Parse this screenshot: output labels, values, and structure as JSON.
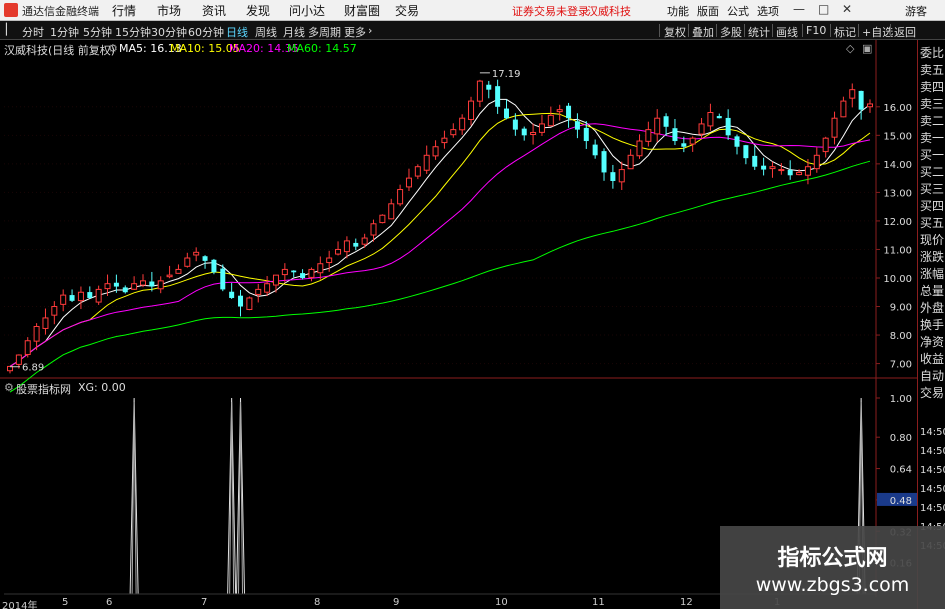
{
  "menubar": {
    "app_title": "通达信金融终端",
    "menus": [
      "行情",
      "市场",
      "资讯",
      "发现",
      "问小达",
      "财富圈",
      "交易"
    ],
    "warning": "证券交易未登录",
    "stock_name": "汉威科技",
    "right_buttons": [
      "功能",
      "版面",
      "公式",
      "选项"
    ],
    "user": "游客"
  },
  "periods": [
    {
      "label": "分时",
      "active": false
    },
    {
      "label": "1分钟",
      "active": false
    },
    {
      "label": "5分钟",
      "active": false
    },
    {
      "label": "15分钟",
      "active": false
    },
    {
      "label": "30分钟",
      "active": false
    },
    {
      "label": "60分钟",
      "active": false
    },
    {
      "label": "日线",
      "active": true
    },
    {
      "label": "周线",
      "active": false
    },
    {
      "label": "月线",
      "active": false
    },
    {
      "label": "多周期",
      "active": false
    },
    {
      "label": "更多",
      "active": false
    }
  ],
  "toolbar_right": [
    "复权",
    "叠加",
    "多股",
    "统计",
    "画线",
    "F10",
    "标记",
    "+自选",
    "返回"
  ],
  "info": {
    "title": "汉威科技(日线 前复权)",
    "ma5": "MA5: 16.13",
    "ma10": "MA10: 15.05",
    "ma20": "MA20: 14.35",
    "ma60": "MA60: 14.57",
    "high_label": "17.19",
    "low_label": "6.89"
  },
  "indicator": {
    "title": "股票指标网",
    "xg": "XG: 0.00"
  },
  "price_axis": {
    "ticks": [
      "16.00",
      "15.00",
      "14.00",
      "13.00",
      "12.00",
      "11.00",
      "10.00",
      "9.00",
      "8.00",
      "7.00"
    ]
  },
  "indicator_axis": {
    "ticks": [
      "1.00",
      "0.80",
      "0.64",
      "0.48",
      "0.32",
      "0.16"
    ],
    "highlight": "0.48"
  },
  "date_axis": [
    "2014年",
    "5",
    "6",
    "7",
    "8",
    "9",
    "10",
    "11",
    "12",
    "1"
  ],
  "right_panel": {
    "labels": [
      "委比",
      "卖五",
      "卖四",
      "卖三",
      "卖二",
      "卖一",
      "买一",
      "买二",
      "买三",
      "买四",
      "买五",
      "现价",
      "涨跌",
      "涨幅",
      "总量",
      "外盘",
      "换手",
      "净资",
      "收益",
      "自动",
      "交易"
    ],
    "times": [
      "14:50",
      "14:50",
      "14:50",
      "14:50",
      "14:50",
      "14:50",
      "14:50"
    ]
  },
  "watermark": {
    "line1": "指标公式网",
    "line2": "www.zbgs3.com"
  },
  "colors": {
    "up": "#ff3b3b",
    "down": "#55ffff",
    "ma5": "#ffffff",
    "ma10": "#ffff00",
    "ma20": "#ff00ff",
    "ma60": "#00ff00",
    "grid": "#8b1e1e"
  },
  "chart_data": [
    {
      "type": "candlestick",
      "title": "汉威科技(日线 前复权)",
      "ylim": [
        6.6,
        17.5
      ],
      "y_ticks": [
        7,
        8,
        9,
        10,
        11,
        12,
        13,
        14,
        15,
        16
      ],
      "x_ticks": [
        "2014年",
        "5",
        "6",
        "7",
        "8",
        "9",
        "10",
        "11",
        "12",
        "1"
      ],
      "close": [
        6.9,
        7.3,
        7.8,
        8.3,
        8.6,
        9.0,
        9.4,
        9.2,
        9.5,
        9.3,
        9.6,
        9.8,
        9.7,
        9.5,
        9.8,
        9.9,
        9.7,
        9.9,
        10.1,
        10.3,
        10.7,
        10.9,
        10.6,
        10.2,
        9.6,
        9.3,
        9.0,
        9.3,
        9.6,
        9.8,
        10.1,
        10.3,
        10.2,
        10.0,
        10.3,
        10.5,
        10.7,
        11.0,
        11.3,
        11.1,
        11.4,
        11.9,
        12.2,
        12.6,
        13.1,
        13.5,
        13.9,
        14.3,
        14.6,
        14.9,
        15.2,
        15.6,
        16.2,
        16.9,
        16.6,
        16.0,
        15.6,
        15.2,
        15.0,
        15.1,
        15.4,
        15.7,
        15.9,
        15.6,
        15.2,
        14.8,
        14.3,
        13.7,
        13.4,
        13.8,
        14.3,
        14.8,
        15.2,
        15.6,
        15.3,
        14.8,
        14.6,
        14.9,
        15.4,
        15.8,
        15.6,
        15.0,
        14.6,
        14.2,
        13.9,
        13.8,
        13.9,
        13.8,
        13.6,
        13.7,
        13.9,
        14.3,
        14.9,
        15.6,
        16.2,
        16.6,
        15.9,
        16.1
      ],
      "series": [
        {
          "name": "MA5",
          "value": 16.13
        },
        {
          "name": "MA10",
          "value": 15.05
        },
        {
          "name": "MA20",
          "value": 14.35
        },
        {
          "name": "MA60",
          "value": 14.57
        }
      ],
      "annotations": [
        {
          "text": "17.19",
          "value": 17.19
        },
        {
          "text": "6.89",
          "value": 6.89
        }
      ]
    },
    {
      "type": "line",
      "title": "股票指标网",
      "ylim": [
        0,
        1.0
      ],
      "y_ticks": [
        0.16,
        0.32,
        0.48,
        0.64,
        0.8,
        1.0
      ],
      "series": [
        {
          "name": "XG",
          "value": 0.0
        }
      ],
      "signal_bars": [
        14,
        25,
        26,
        96
      ]
    }
  ]
}
